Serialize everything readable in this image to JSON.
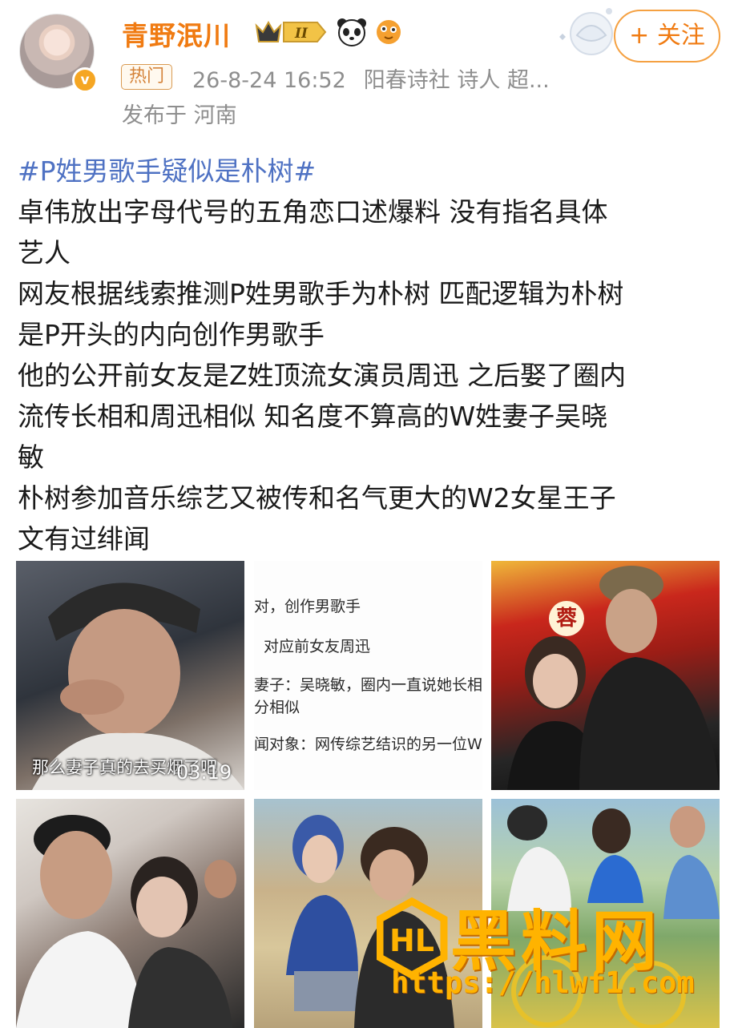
{
  "user": {
    "name": "青野泯川",
    "level_badge": "II",
    "follow_label": "+ 关注"
  },
  "post_meta": {
    "hot_label": "热门",
    "time": "26-8-24 16:52",
    "source": "阳春诗社 诗人 超...",
    "location": "发布于 河南"
  },
  "post": {
    "hashtag": "#P姓男歌手疑似是朴树#",
    "lines": [
      "卓伟放出字母代号的五角恋口述爆料 没有指名具体",
      "艺人",
      "网友根据线索推测P姓男歌手为朴树 匹配逻辑为朴树",
      "是P开头的内向创作男歌手",
      "他的公开前女友是Z姓顶流女演员周迅 之后娶了圈内",
      "流传长相和周迅相似 知名度不算高的W姓妻子吴晓",
      "敏",
      "朴树参加音乐综艺又被传和名气更大的W2女星王子",
      "文有过绯闻"
    ]
  },
  "images": {
    "video_caption": "那么妻子真的去买烟了吧",
    "video_duration": "03:19",
    "text_shot_lines": [
      "对，创作男歌手",
      "对应前女友周迅",
      "妻子：吴晓敏，圈内一直说她长相",
      "分相似",
      "闻对象：网传综艺结识的另一位W姐"
    ],
    "sign_text": "蓉"
  },
  "watermark": {
    "title": "黑料网",
    "url": "https://hlwf1.com"
  },
  "colors": {
    "username": "#f07b12",
    "hashtag": "#4f72c3",
    "meta": "#8e8e8e",
    "watermark": "#ffb300"
  }
}
